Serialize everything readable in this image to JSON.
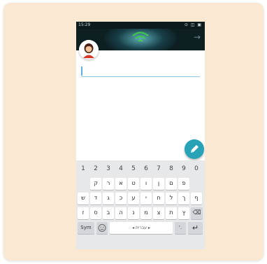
{
  "status_bar": {
    "time": "15:29",
    "icons": "⊙ ◫ ▣"
  },
  "keyboard": {
    "numbers": [
      "1",
      "2",
      "3",
      "4",
      "5",
      "6",
      "7",
      "8",
      "9",
      "0"
    ],
    "row1": [
      "ק",
      "ר",
      "א",
      "ט",
      "ו",
      "ן",
      "ם",
      "פ"
    ],
    "row2": [
      "ש",
      "ד",
      "ג",
      "כ",
      "ע",
      "י",
      "ח",
      "ל",
      "ך",
      "ף"
    ],
    "row3": [
      "ז",
      "ס",
      "ב",
      "ה",
      "נ",
      "מ",
      "צ",
      "ת",
      "ץ"
    ],
    "sym_label": "Sym",
    "space_label": "◂ עברית ▸",
    "punct_label": "'.",
    "enter_symbol": "↵",
    "backspace_symbol": "⌫"
  },
  "colors": {
    "accent": "#27a2b6",
    "topbar": "#0e1f22",
    "wifi": "#3ecf4a",
    "page_bg": "#fbe8d2"
  }
}
